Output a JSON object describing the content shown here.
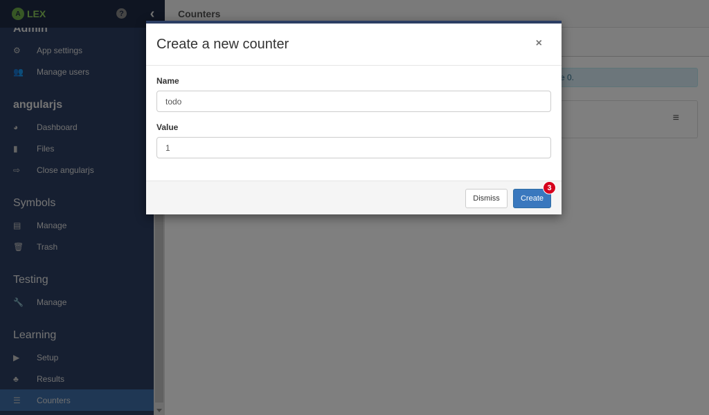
{
  "app": {
    "logo_letter": "A",
    "logo_text": "LEX",
    "help_icon": "question-circle-icon",
    "collapse_icon": "chevron-left-icon"
  },
  "sidebar": {
    "sections": [
      {
        "title": "Admin",
        "items": [
          {
            "label": "App settings",
            "icon": "cogs-icon",
            "glyph": "⚙"
          },
          {
            "label": "Manage users",
            "icon": "users-icon",
            "glyph": "👥"
          }
        ]
      },
      {
        "title": "angularjs",
        "items": [
          {
            "label": "Dashboard",
            "icon": "dashboard-icon",
            "glyph": "◕"
          },
          {
            "label": "Files",
            "icon": "file-icon",
            "glyph": "▮"
          },
          {
            "label": "Close angularjs",
            "icon": "sign-out-icon",
            "glyph": "⇨"
          }
        ]
      },
      {
        "title": "Symbols",
        "items": [
          {
            "label": "Manage",
            "icon": "list-alt-icon",
            "glyph": "▤"
          },
          {
            "label": "Trash",
            "icon": "trash-icon",
            "glyph": "🗑"
          }
        ]
      },
      {
        "title": "Testing",
        "items": [
          {
            "label": "Manage",
            "icon": "wrench-icon",
            "glyph": "🔧"
          }
        ]
      },
      {
        "title": "Learning",
        "items": [
          {
            "label": "Setup",
            "icon": "play-icon",
            "glyph": "▶"
          },
          {
            "label": "Results",
            "icon": "sitemap-icon",
            "glyph": "♣"
          },
          {
            "label": "Counters",
            "icon": "list-ol-icon",
            "glyph": "☰",
            "active": true
          }
        ]
      }
    ]
  },
  "main": {
    "page_title": "Counters",
    "alert_text_visible": "e 0.",
    "panel_menu_icon": "bars-icon"
  },
  "modal": {
    "title": "Create a new counter",
    "close_glyph": "×",
    "fields": {
      "name": {
        "label": "Name",
        "value": "todo"
      },
      "value": {
        "label": "Value",
        "value": "1"
      }
    },
    "buttons": {
      "dismiss": "Dismiss",
      "create": "Create"
    },
    "badge": "3"
  }
}
